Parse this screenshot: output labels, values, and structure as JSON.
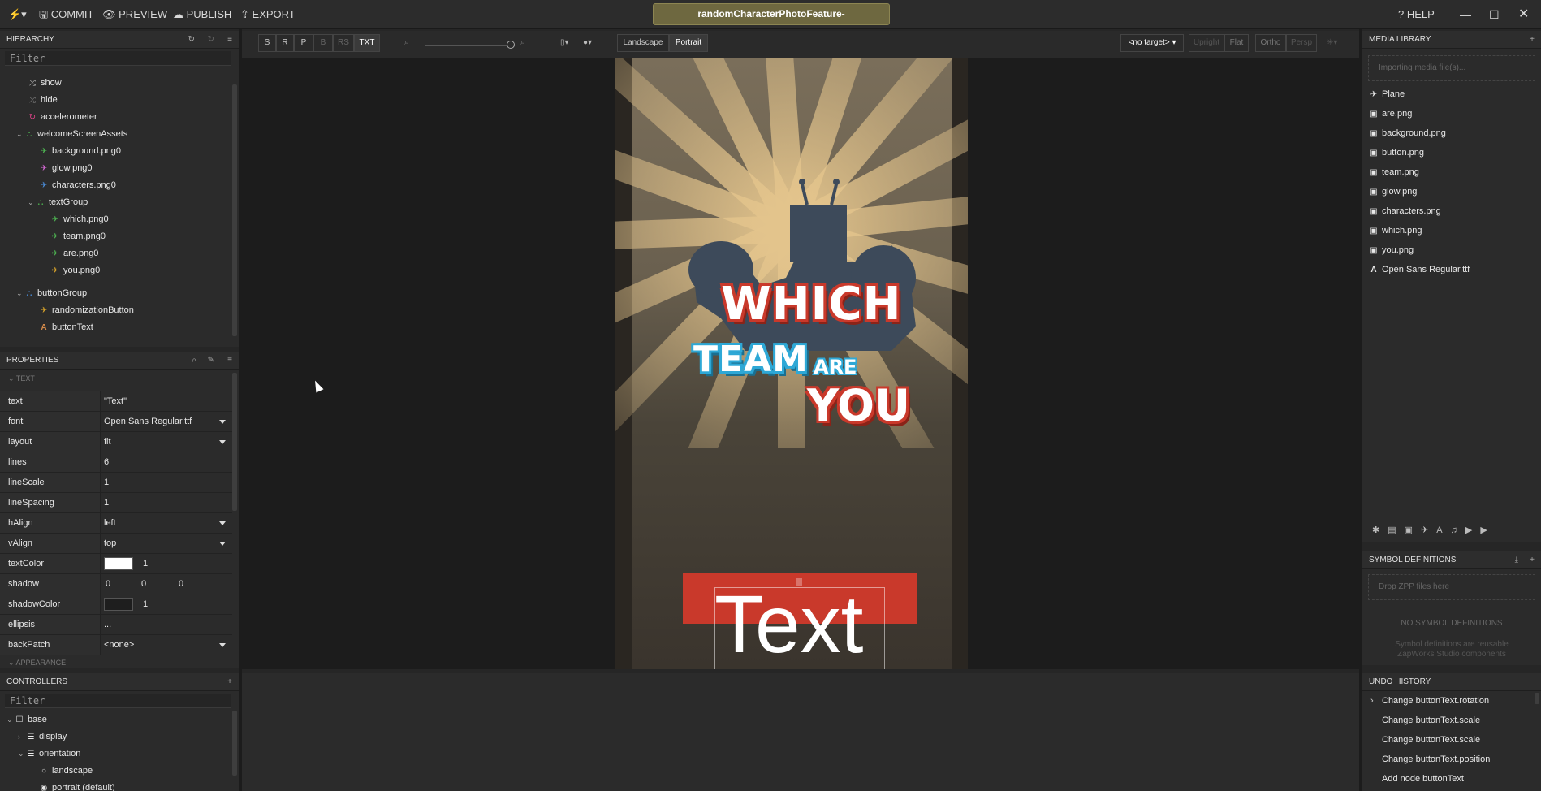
{
  "topbar": {
    "commit": "COMMIT",
    "preview": "PREVIEW",
    "publish": "PUBLISH",
    "export": "EXPORT",
    "project_title": "randomCharacterPhotoFeature-",
    "help": "HELP"
  },
  "hierarchy": {
    "title": "HIERARCHY",
    "filter_placeholder": "Filter",
    "items": [
      {
        "label": "show",
        "icon": "shuffle-icon"
      },
      {
        "label": "hide",
        "icon": "shuffle-icon"
      },
      {
        "label": "accelerometer",
        "icon": "cycle-icon"
      },
      {
        "label": "welcomeScreenAssets",
        "icon": "group-icon"
      },
      {
        "label": "background.png0",
        "icon": "plane-icon"
      },
      {
        "label": "glow.png0",
        "icon": "plane-icon"
      },
      {
        "label": "characters.png0",
        "icon": "plane-icon"
      },
      {
        "label": "textGroup",
        "icon": "group-icon"
      },
      {
        "label": "which.png0",
        "icon": "plane-icon"
      },
      {
        "label": "team.png0",
        "icon": "plane-icon"
      },
      {
        "label": "are.png0",
        "icon": "plane-icon"
      },
      {
        "label": "you.png0",
        "icon": "plane-icon"
      },
      {
        "label": "buttonGroup",
        "icon": "group-icon"
      },
      {
        "label": "randomizationButton",
        "icon": "plane-icon"
      },
      {
        "label": "buttonText",
        "icon": "text-icon"
      }
    ]
  },
  "properties": {
    "title": "PROPERTIES",
    "section": "TEXT",
    "section2": "APPEARANCE",
    "rows": [
      {
        "label": "text",
        "value": "\"Text\""
      },
      {
        "label": "font",
        "value": "Open Sans Regular.ttf"
      },
      {
        "label": "layout",
        "value": "fit"
      },
      {
        "label": "lines",
        "value": "6"
      },
      {
        "label": "lineScale",
        "value": "1"
      },
      {
        "label": "lineSpacing",
        "value": "1"
      },
      {
        "label": "hAlign",
        "value": "left"
      },
      {
        "label": "vAlign",
        "value": "top"
      },
      {
        "label": "textColor",
        "value": "1"
      },
      {
        "label": "shadow",
        "value": "0",
        "value2": "0",
        "value3": "0"
      },
      {
        "label": "shadowColor",
        "value": "1"
      },
      {
        "label": "ellipsis",
        "value": "..."
      },
      {
        "label": "backPatch",
        "value": "<none>"
      }
    ],
    "text_color": "#ffffff",
    "shadow_color": "#1e1e1e"
  },
  "controllers": {
    "title": "CONTROLLERS",
    "filter_placeholder": "Filter",
    "items": [
      {
        "label": "base"
      },
      {
        "label": "display"
      },
      {
        "label": "orientation"
      },
      {
        "label": "landscape"
      },
      {
        "label": "portrait (default)"
      }
    ]
  },
  "viewport": {
    "modes": [
      "S",
      "R",
      "P",
      "B",
      "RS",
      "TXT"
    ],
    "landscape": "Landscape",
    "portrait": "Portrait",
    "target": "<no target>",
    "upright": "Upright",
    "flat": "Flat",
    "ortho": "Ortho",
    "persp": "Persp"
  },
  "artwork": {
    "which": "WHICH",
    "team": "TEAM",
    "are": "ARE",
    "you": "YOU",
    "button_text": "Text"
  },
  "media": {
    "title": "MEDIA LIBRARY",
    "importing": "Importing media file(s)...",
    "items": [
      {
        "label": "Plane",
        "icon": "plane-icon"
      },
      {
        "label": "are.png",
        "icon": "image-icon"
      },
      {
        "label": "background.png",
        "icon": "image-icon"
      },
      {
        "label": "button.png",
        "icon": "image-icon"
      },
      {
        "label": "team.png",
        "icon": "image-icon"
      },
      {
        "label": "glow.png",
        "icon": "image-icon"
      },
      {
        "label": "characters.png",
        "icon": "image-icon"
      },
      {
        "label": "which.png",
        "icon": "image-icon"
      },
      {
        "label": "you.png",
        "icon": "image-icon"
      },
      {
        "label": "Open Sans Regular.ttf",
        "icon": "font-icon"
      }
    ]
  },
  "symbols": {
    "title": "SYMBOL DEFINITIONS",
    "drop": "Drop ZPP files here",
    "empty": "NO SYMBOL DEFINITIONS",
    "desc": "Symbol definitions are reusable ZapWorks Studio components"
  },
  "undo": {
    "title": "UNDO HISTORY",
    "items": [
      "Change buttonText.rotation",
      "Change buttonText.scale",
      "Change buttonText.scale",
      "Change buttonText.position",
      "Add node buttonText"
    ]
  },
  "colors": {
    "accent_red": "#c9392b",
    "accent_blue": "#2ea8d6",
    "title_pill": "#6e6840"
  }
}
